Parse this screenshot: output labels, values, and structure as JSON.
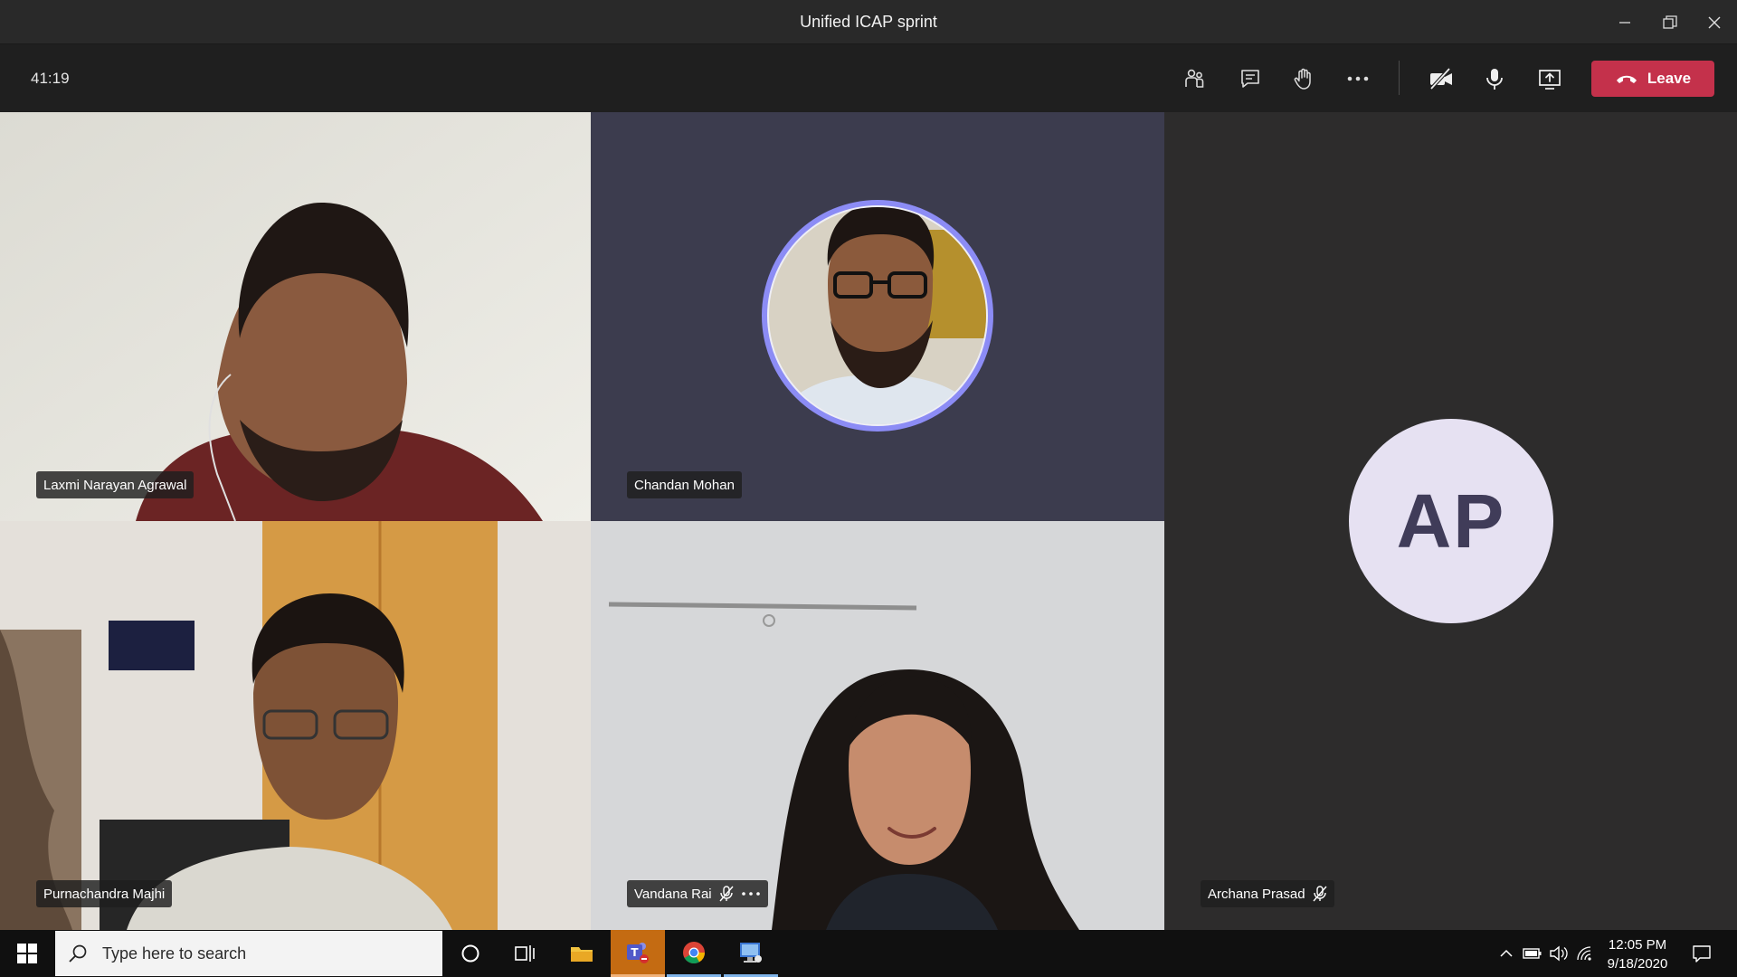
{
  "window": {
    "title": "Unified ICAP sprint"
  },
  "meeting": {
    "timer": "41:19",
    "leave_label": "Leave",
    "controls": [
      "participants-icon",
      "chat-icon",
      "raise-hand-icon",
      "more-options-icon",
      "camera-off-icon",
      "microphone-icon",
      "share-screen-icon"
    ]
  },
  "participants": [
    {
      "name": "Laxmi Narayan Agrawal"
    },
    {
      "name": "Chandan Mohan"
    },
    {
      "name": "Purnachandra Majhi"
    },
    {
      "name": "Vandana Rai"
    },
    {
      "name": "Archana Prasad",
      "initials": "AP"
    }
  ],
  "colors": {
    "leave": "#c4314b",
    "avatar_ring": "#8c8cf5",
    "initials_avatar_bg": "#e6e1f2",
    "initials_text": "#403c59",
    "teams_active": "#c46b12"
  },
  "taskbar": {
    "search_placeholder": "Type here to search",
    "time": "12:05 PM",
    "date": "9/18/2020"
  }
}
